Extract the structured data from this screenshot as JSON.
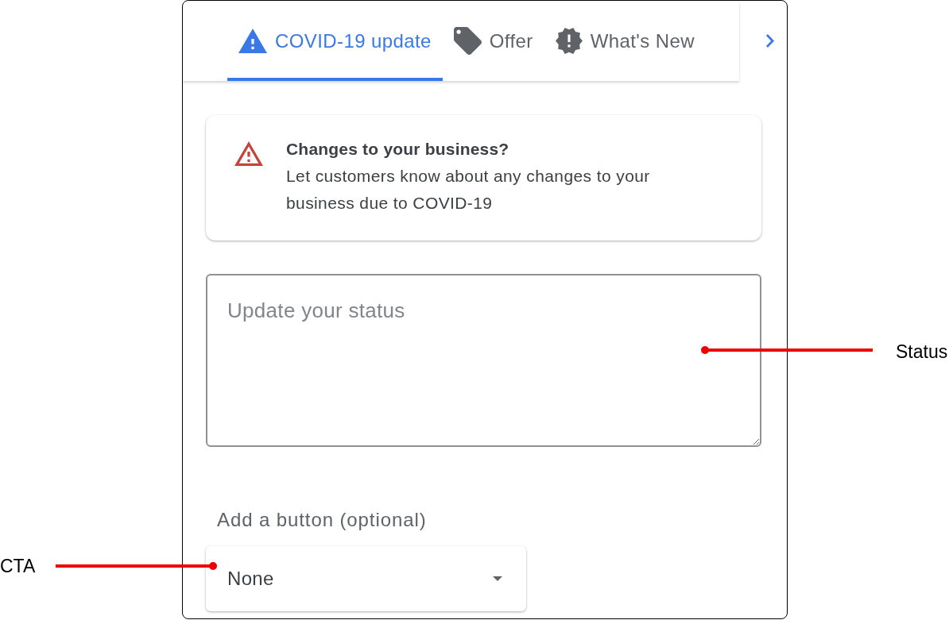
{
  "tabs": [
    {
      "label": "COVID-19 update",
      "selected": true
    },
    {
      "label": "Offer",
      "selected": false
    },
    {
      "label": "What's New",
      "selected": false
    }
  ],
  "notice": {
    "title": "Changes to your business?",
    "text": "Let customers know about any changes to your business due to COVID-19"
  },
  "status_field": {
    "placeholder": "Update your status"
  },
  "button_section": {
    "label": "Add a button (optional)",
    "dropdown": {
      "value": "None"
    }
  },
  "annotations": [
    {
      "kind": "right",
      "label": "Status"
    },
    {
      "kind": "left",
      "label": "CTA"
    }
  ]
}
